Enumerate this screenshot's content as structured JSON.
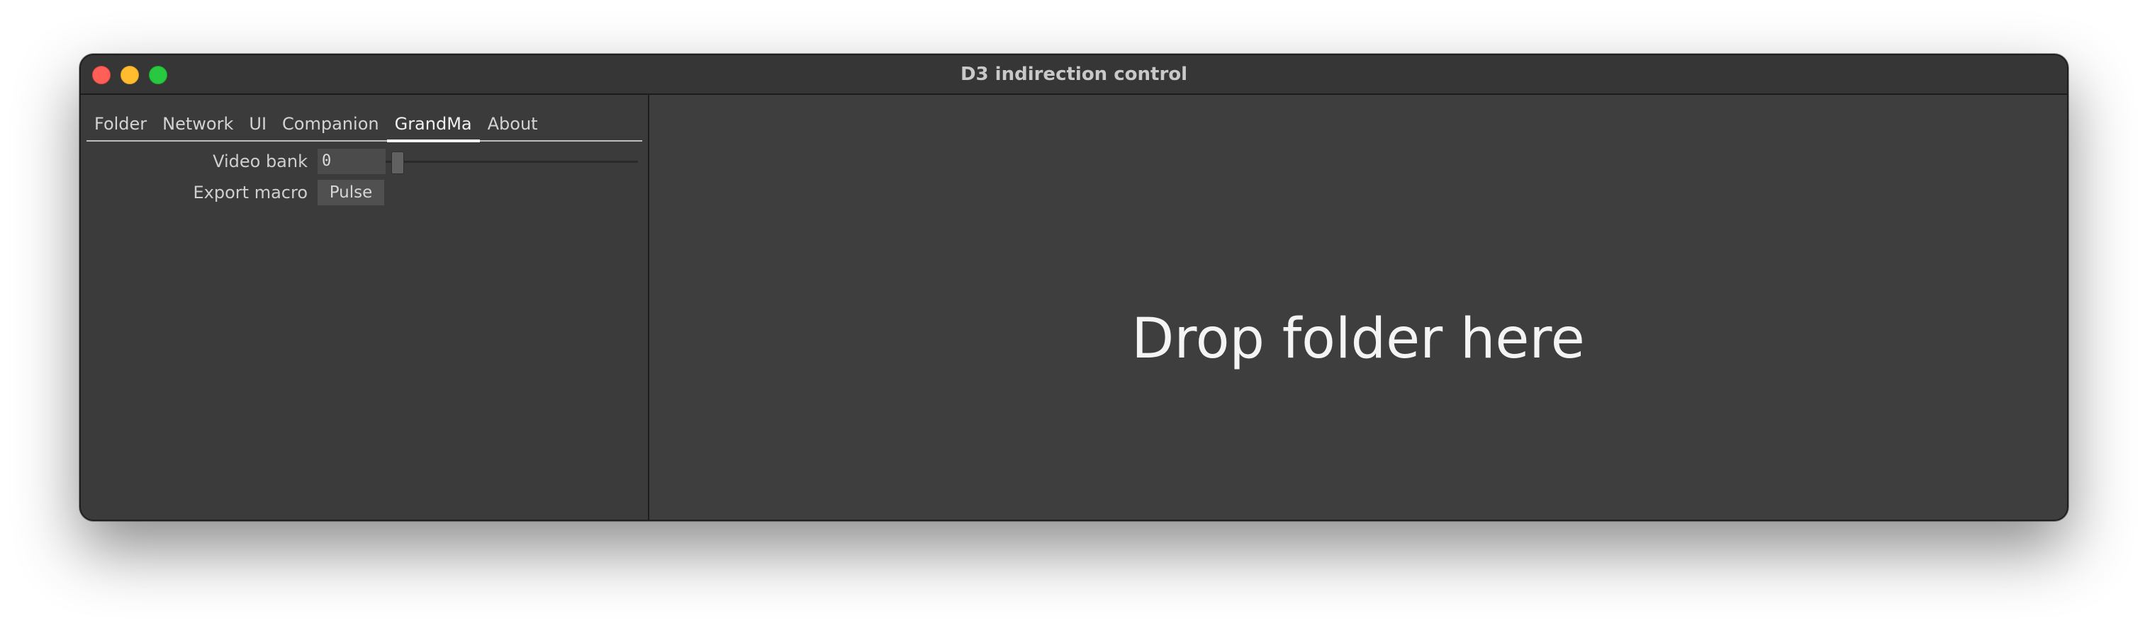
{
  "window": {
    "title": "D3 indirection control"
  },
  "tabs": [
    {
      "label": "Folder"
    },
    {
      "label": "Network"
    },
    {
      "label": "UI"
    },
    {
      "label": "Companion"
    },
    {
      "label": "GrandMa",
      "active": true
    },
    {
      "label": "About"
    }
  ],
  "grandma": {
    "video_bank_label": "Video bank",
    "video_bank_value": "0",
    "export_macro_label": "Export macro",
    "pulse_label": "Pulse"
  },
  "main": {
    "drop_text": "Drop folder here"
  },
  "colors": {
    "close": "#ff5f57",
    "minimize": "#febc2e",
    "maximize": "#28c840",
    "background": "#3e3e3e"
  },
  "icons": {
    "close": "close-icon",
    "minimize": "minimize-icon",
    "maximize": "maximize-icon"
  }
}
